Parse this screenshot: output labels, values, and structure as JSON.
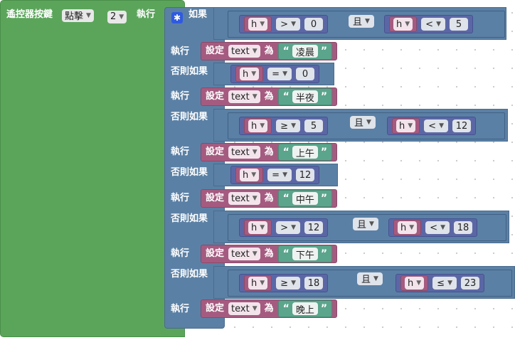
{
  "event": {
    "label": "遙控器按鍵",
    "action_value": "點擊",
    "key_value": "2",
    "do_label": "執行"
  },
  "if_block": {
    "if_label": "如果",
    "do_label": "執行",
    "elseif_label": "否則如果",
    "set_label": "設定",
    "to_label": "為",
    "var_name": "text",
    "cond_var": "h",
    "and_label": "且",
    "quote_open": "“",
    "quote_close": "”"
  },
  "branches": [
    {
      "cond": {
        "op1": ">",
        "val1": "0",
        "op2": "<",
        "val2": "5",
        "compound": true
      },
      "value": "凌晨"
    },
    {
      "cond": {
        "op1": "=",
        "val1": "0",
        "compound": false
      },
      "value": "半夜"
    },
    {
      "cond": {
        "op1": "≥",
        "val1": "5",
        "op2": "<",
        "val2": "12",
        "compound": true
      },
      "value": "上午"
    },
    {
      "cond": {
        "op1": "=",
        "val1": "12",
        "compound": false
      },
      "value": "中午"
    },
    {
      "cond": {
        "op1": ">",
        "val1": "12",
        "op2": "<",
        "val2": "18",
        "compound": true
      },
      "value": "下午"
    },
    {
      "cond": {
        "op1": "≥",
        "val1": "18",
        "op2": "≤",
        "val2": "23",
        "compound": true
      },
      "value": "晚上"
    }
  ],
  "colors": {
    "event_green": "#5ba55b",
    "logic_blue": "#5b80a5",
    "compare_indigo": "#5b67a5",
    "variable_magenta": "#a55b80",
    "text_teal": "#5ba58c"
  }
}
